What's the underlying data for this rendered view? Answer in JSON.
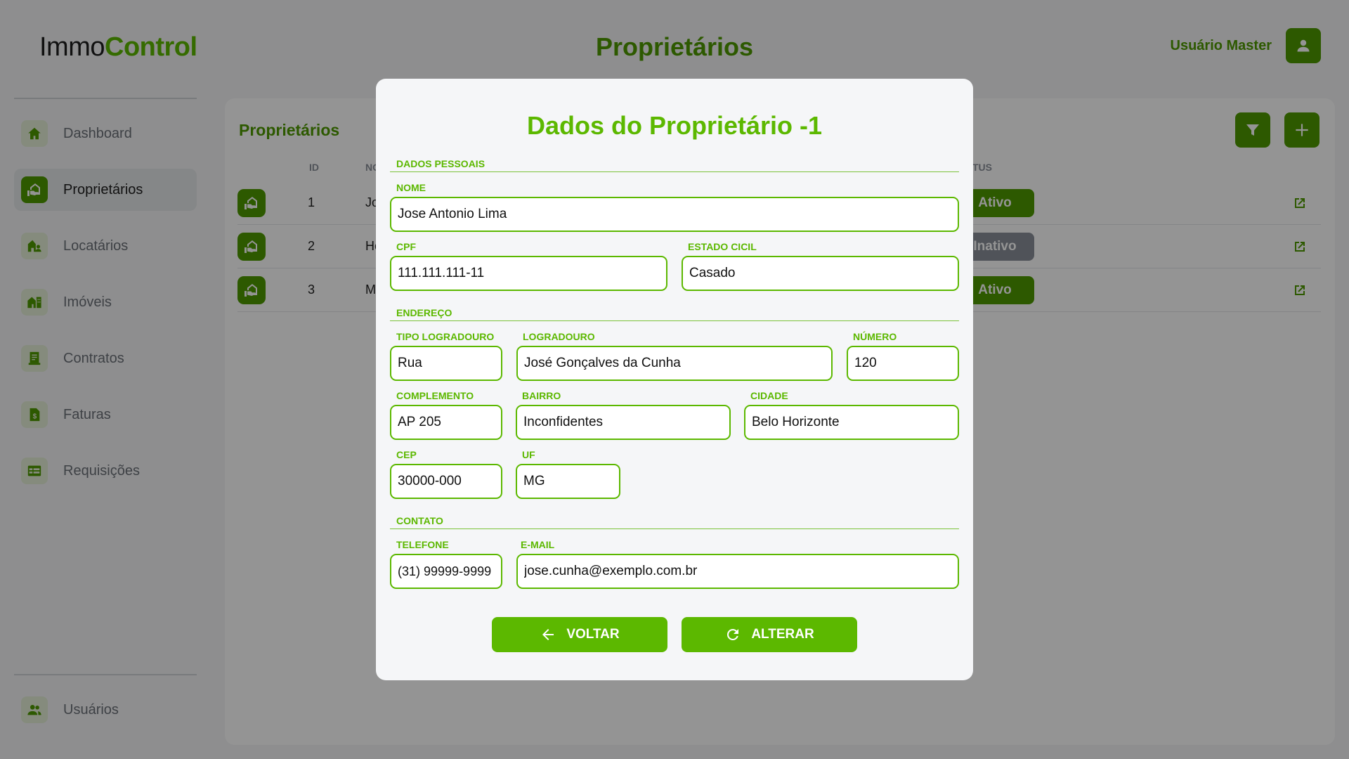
{
  "header": {
    "logo_part1": "Immo",
    "logo_part2": "Control",
    "title": "Proprietários",
    "user_name": "Usuário Master"
  },
  "sidebar": {
    "items": [
      {
        "label": "Dashboard",
        "icon": "home-icon"
      },
      {
        "label": "Proprietários",
        "icon": "owner-icon",
        "active": true
      },
      {
        "label": "Locatários",
        "icon": "tenant-icon"
      },
      {
        "label": "Imóveis",
        "icon": "property-icon"
      },
      {
        "label": "Contratos",
        "icon": "contract-icon"
      },
      {
        "label": "Faturas",
        "icon": "invoice-icon"
      },
      {
        "label": "Requisições",
        "icon": "request-icon"
      }
    ],
    "footer_item": {
      "label": "Usuários",
      "icon": "users-icon"
    }
  },
  "list": {
    "title": "Proprietários",
    "columns": {
      "id": "ID",
      "name": "NO",
      "status": "TUS"
    },
    "rows": [
      {
        "id": "1",
        "name": "Jo",
        "status": "Ativo"
      },
      {
        "id": "2",
        "name": "He",
        "status": "Inativo"
      },
      {
        "id": "3",
        "name": "M",
        "status": "Ativo"
      }
    ]
  },
  "modal": {
    "title": "Dados do Proprietário -1",
    "sections": {
      "personal": "DADOS PESSOAIS",
      "address": "ENDEREÇO",
      "contact": "CONTATO"
    },
    "labels": {
      "nome": "NOME",
      "cpf": "CPF",
      "estado_civil": "ESTADO CICIL",
      "tipo_logradouro": "TIPO LOGRADOURO",
      "logradouro": "LOGRADOURO",
      "numero": "NÚMERO",
      "complemento": "COMPLEMENTO",
      "bairro": "BAIRRO",
      "cidade": "CIDADE",
      "cep": "CEP",
      "uf": "UF",
      "telefone": "TELEFONE",
      "email": "E-MAIL"
    },
    "values": {
      "nome": "Jose Antonio Lima",
      "cpf": "111.111.111-11",
      "estado_civil": "Casado",
      "tipo_logradouro": "Rua",
      "logradouro": "José Gonçalves da Cunha",
      "numero": "120",
      "complemento": "AP 205",
      "bairro": "Inconfidentes",
      "cidade": "Belo Horizonte",
      "cep": "30000-000",
      "uf": "MG",
      "telefone": "(31) 99999-9999",
      "email": "jose.cunha@exemplo.com.br"
    },
    "buttons": {
      "back": "VOLTAR",
      "update": "ALTERAR"
    }
  },
  "colors": {
    "accent": "#5cb800",
    "accent_dark": "#4e9a00",
    "status_active": "#4e9a00",
    "status_inactive": "#8a9099"
  }
}
